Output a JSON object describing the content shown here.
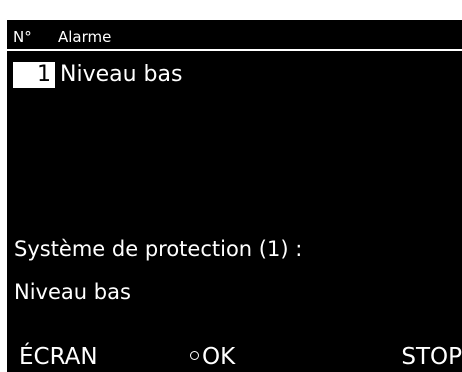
{
  "colors": {
    "screen_bg": "#000000",
    "text": "#ffffff",
    "highlight_bg": "#ffffff",
    "highlight_text": "#000000"
  },
  "header": {
    "number_label": "N°",
    "alarm_label": "Alarme"
  },
  "alarm_list": [
    {
      "index": "1",
      "name": "Niveau bas",
      "selected": true
    }
  ],
  "detail": {
    "title": "Système de protection (1) :",
    "value": "Niveau bas"
  },
  "softkeys": {
    "left": "ÉCRAN",
    "center": "OK",
    "center_icon": "circle-icon",
    "right": "STOP"
  }
}
